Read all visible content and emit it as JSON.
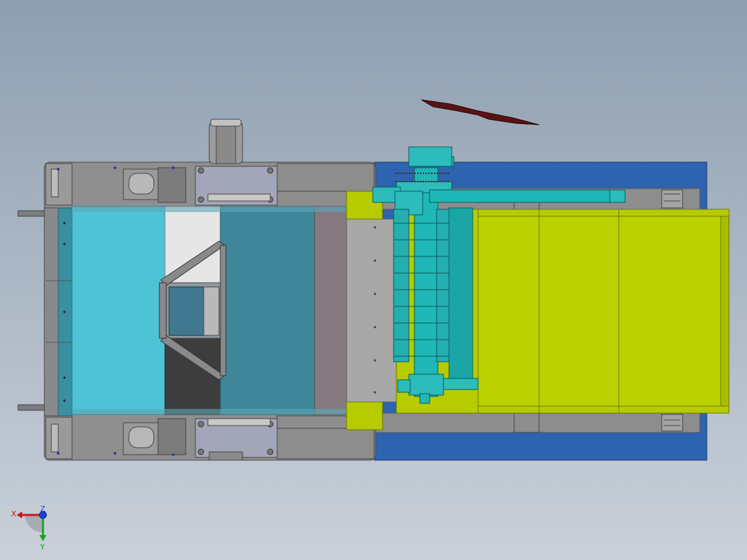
{
  "viewport": {
    "colors": {
      "background_top": "#8e9fb0",
      "background_bottom": "#c9d0da",
      "frame_grey": "#8f8f8f",
      "frame_blue": "#2e63b0",
      "cyan_light": "#4fc3d6",
      "teal": "#3f8798",
      "yellow_green": "#b6cc00",
      "cyan_parts": "#1fb7b7",
      "dark_red": "#5a1313",
      "mauve": "#857a80"
    }
  },
  "triad": {
    "x_label": "X",
    "y_label": "Y",
    "z_label": "Z"
  }
}
